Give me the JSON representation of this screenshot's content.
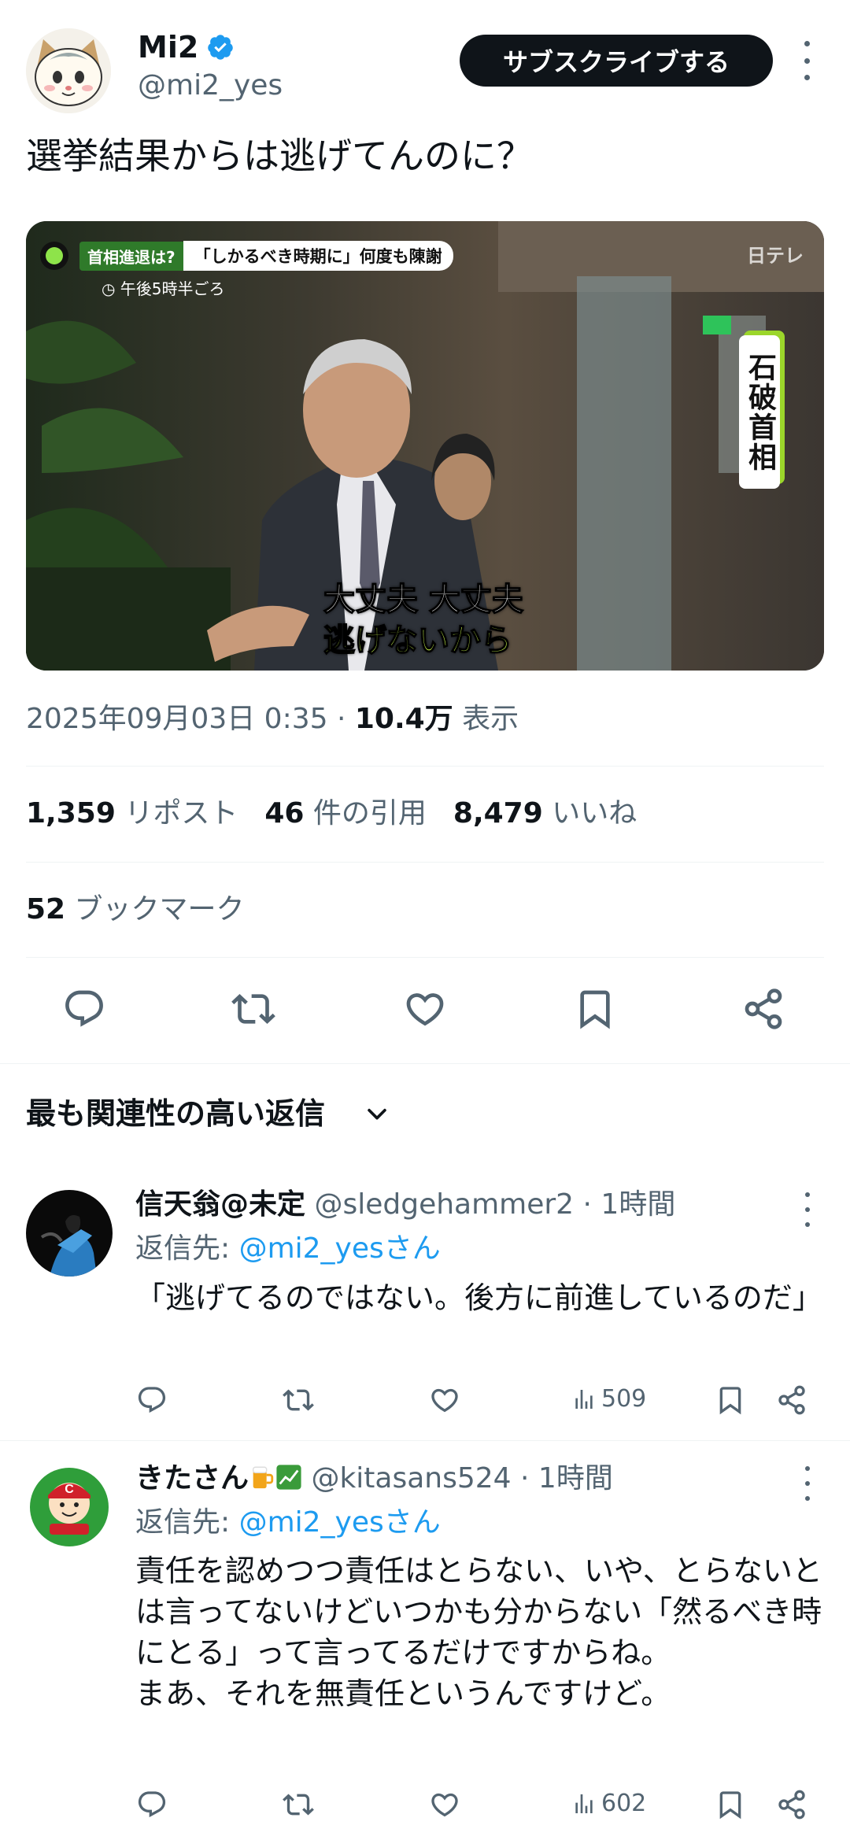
{
  "tweet": {
    "author_name": "Mi2",
    "author_handle": "@mi2_yes",
    "subscribe_label": "サブスクライブする",
    "text": "選挙結果からは逃げてんのに？",
    "media": {
      "caption_tag": "首相進退は?",
      "caption_main": "「しかるべき時期に」何度も陳謝",
      "caption_time": "◷ 午後5時半ごろ",
      "logo": "日テレ",
      "name_plate": "石破首相",
      "subtitle_line1": "大丈夫 大丈夫",
      "subtitle_line2": "逃げないから"
    },
    "timestamp": "2025年09月03日 0:35 · ",
    "views_count": "10.4万",
    "views_label": " 表示",
    "stats": {
      "reposts_count": "1,359",
      "reposts_label": " リポスト",
      "quotes_count": "46",
      "quotes_label": " 件の引用",
      "likes_count": "8,479",
      "likes_label": " いいね",
      "bookmarks_count": "52",
      "bookmarks_label": " ブックマーク"
    },
    "actions": [
      "reply-icon",
      "repost-icon",
      "like-icon",
      "bookmark-icon",
      "share-icon"
    ]
  },
  "replies_section": {
    "title": "最も関連性の高い返信"
  },
  "replies": [
    {
      "name": "信天翁@未定",
      "handle": " @sledgehammer2 · 1時間",
      "reply_to_label": "返信先: ",
      "reply_to_mention": "@mi2_yesさん",
      "body": "「逃げてるのではない。後方に前進しているのだ」",
      "views": "509"
    },
    {
      "name": "きたさん",
      "handle": " @kitasans524 · 1時間",
      "reply_to_label": "返信先: ",
      "reply_to_mention": "@mi2_yesさん",
      "body": "責任を認めつつ責任はとらない、いや、とらないとは言ってないけどいつかも分からない「然るべき時にとる」って言ってるだけですからね。\nまあ、それを無責任というんですけど。",
      "views": "602"
    }
  ],
  "colors": {
    "text_primary": "#0f1419",
    "text_secondary": "#536471",
    "link": "#1d9bf0",
    "verified": "#1d9bf0",
    "divider": "#eff3f4"
  }
}
